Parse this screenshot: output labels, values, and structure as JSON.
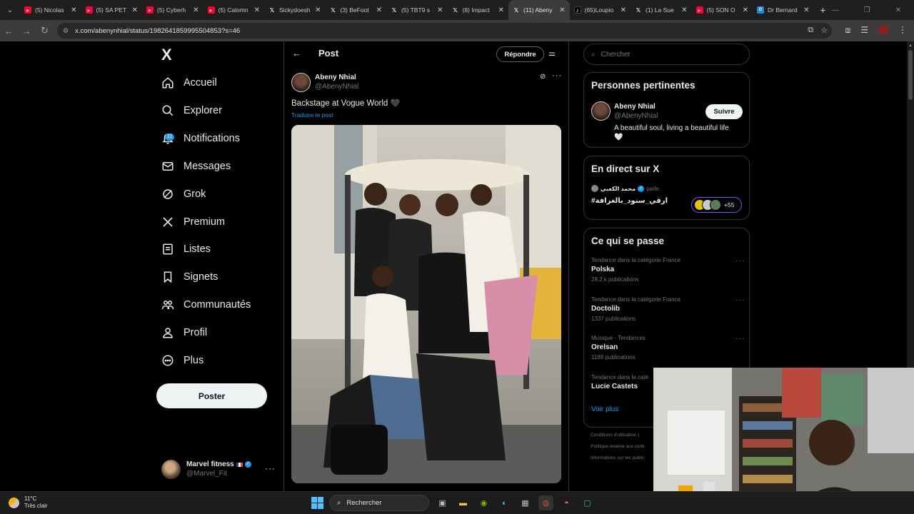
{
  "browser": {
    "tabs": [
      {
        "label": "(5) Nicolas",
        "icon": "youtube-icon"
      },
      {
        "label": "(5) SA PET",
        "icon": "youtube-icon"
      },
      {
        "label": "(5) Cyberh",
        "icon": "youtube-icon"
      },
      {
        "label": "(5) Calomn",
        "icon": "youtube-icon"
      },
      {
        "label": "Sickydoesh",
        "icon": "x-icon"
      },
      {
        "label": "(3) BeFoot",
        "icon": "x-icon"
      },
      {
        "label": "(5) TBT9 s",
        "icon": "x-icon"
      },
      {
        "label": "(8) Impact",
        "icon": "x-icon"
      },
      {
        "label": "(11) Abeny",
        "icon": "x-icon",
        "active": true
      },
      {
        "label": "(65)Loupio",
        "icon": "tiktok-icon"
      },
      {
        "label": "(1) La Sue",
        "icon": "x-icon"
      },
      {
        "label": "(5) SON O",
        "icon": "youtube-icon"
      },
      {
        "label": "Dr Bernard",
        "icon": "doctolib-icon"
      }
    ],
    "url": "x.com/abenynhial/status/1982641859995504853?s=46"
  },
  "nav": {
    "logo": "X",
    "items": [
      {
        "label": "Accueil",
        "icon": "home-icon"
      },
      {
        "label": "Explorer",
        "icon": "search-icon"
      },
      {
        "label": "Notifications",
        "icon": "bell-icon",
        "badge": "11"
      },
      {
        "label": "Messages",
        "icon": "envelope-icon"
      },
      {
        "label": "Grok",
        "icon": "grok-icon"
      },
      {
        "label": "Premium",
        "icon": "x-icon"
      },
      {
        "label": "Listes",
        "icon": "list-icon"
      },
      {
        "label": "Signets",
        "icon": "bookmark-icon"
      },
      {
        "label": "Communautés",
        "icon": "communities-icon"
      },
      {
        "label": "Profil",
        "icon": "user-icon"
      },
      {
        "label": "Plus",
        "icon": "more-circle-icon"
      }
    ],
    "post_button": "Poster",
    "account": {
      "name": "Marvel fitness",
      "handle": "@Marvel_Fit"
    }
  },
  "main": {
    "header_title": "Post",
    "reply_button": "Répondre",
    "post": {
      "author_name": "Abeny Nhial",
      "author_handle": "@AbenyNhial",
      "text": "Backstage at Vogue World",
      "emoji": "🖤",
      "translate": "Traduire le post"
    }
  },
  "right": {
    "search_placeholder": "Chercher",
    "relevant": {
      "title": "Personnes pertinentes",
      "name": "Abeny Nhial",
      "handle": "@AbenyNhial",
      "follow": "Suivre",
      "bio": "A beautiful soul, living a beautiful life",
      "bio_emoji": "🤍"
    },
    "live": {
      "title": "En direct sur X",
      "host": "محمد الكعبي",
      "host_suffix": "parle.",
      "topic": "#ارقي_سنود_بالغرافة",
      "count": "+55"
    },
    "trends": {
      "title": "Ce qui se passe",
      "items": [
        {
          "category": "Tendance dans la catégorie France",
          "name": "Polska",
          "count": "28,2 k publications"
        },
        {
          "category": "Tendance dans la catégorie France",
          "name": "Doctolib",
          "count": "1337 publications"
        },
        {
          "category": "Musique · Tendances",
          "name": "Orelsan",
          "count": "1188 publications"
        },
        {
          "category": "Tendance dans la caté",
          "name": "Lucie Castets",
          "count": ""
        }
      ],
      "see_more": "Voir plus"
    },
    "footer": [
      "Conditions d'utilisation  |",
      "Politique relative aux cook",
      "Informations sur les public"
    ]
  },
  "taskbar": {
    "temp": "11°C",
    "weather": "Très clair",
    "search": "Rechercher"
  },
  "colors": {
    "accent": "#1d9bf0",
    "background": "#000000",
    "border": "#2f3336",
    "muted": "#71767b"
  }
}
